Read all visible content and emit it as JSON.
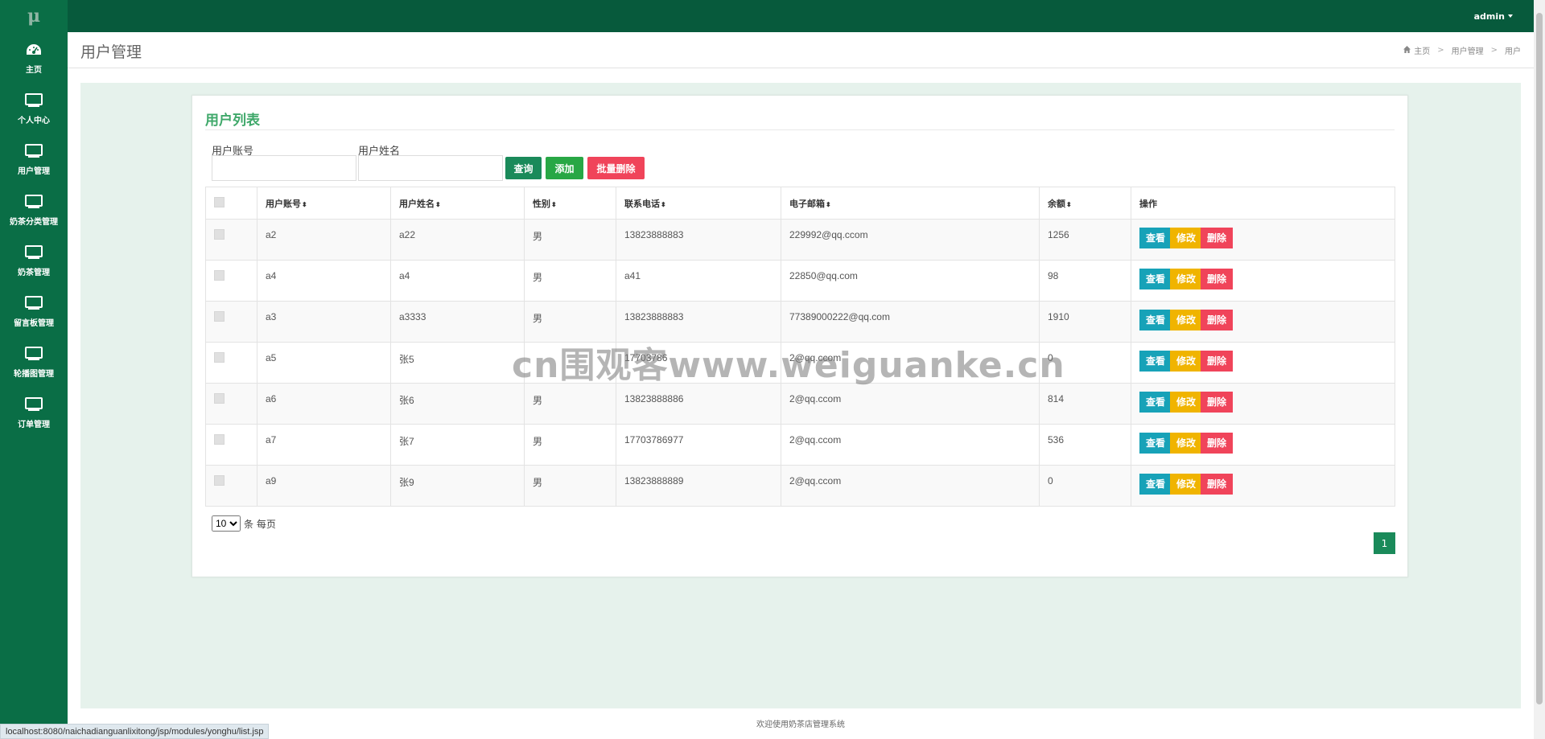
{
  "app": {
    "logo": "μ"
  },
  "sidebar": {
    "items": [
      {
        "label": "主页",
        "icon": "dashboard-icon"
      },
      {
        "label": "个人中心",
        "icon": "monitor-icon"
      },
      {
        "label": "用户管理",
        "icon": "monitor-icon"
      },
      {
        "label": "奶茶分类管理",
        "icon": "monitor-icon"
      },
      {
        "label": "奶茶管理",
        "icon": "monitor-icon"
      },
      {
        "label": "留言板管理",
        "icon": "monitor-icon"
      },
      {
        "label": "轮播图管理",
        "icon": "monitor-icon"
      },
      {
        "label": "订单管理",
        "icon": "monitor-icon"
      }
    ]
  },
  "topbar": {
    "user": "admin"
  },
  "header": {
    "title": "用户管理",
    "breadcrumb": [
      "主页",
      "用户管理",
      "用户"
    ]
  },
  "card": {
    "title": "用户列表",
    "search": {
      "account_label": "用户账号",
      "account_value": "",
      "name_label": "用户姓名",
      "name_value": ""
    },
    "buttons": {
      "query": "查询",
      "add": "添加",
      "batch_delete": "批量删除"
    }
  },
  "table": {
    "columns": [
      "用户账号",
      "用户姓名",
      "性别",
      "联系电话",
      "电子邮箱",
      "余额",
      "操作"
    ],
    "rows": [
      [
        "a2",
        "a22",
        "男",
        "13823888883",
        "229992@qq.ccom",
        "1256"
      ],
      [
        "a4",
        "a4",
        "男",
        "a41",
        "22850@qq.com",
        "98"
      ],
      [
        "a3",
        "a3333",
        "男",
        "13823888883",
        "77389000222@qq.com",
        "1910"
      ],
      [
        "a5",
        "张5",
        "",
        "17703786",
        "2@qq.ccom",
        "0"
      ],
      [
        "a6",
        "张6",
        "男",
        "13823888886",
        "2@qq.ccom",
        "814"
      ],
      [
        "a7",
        "张7",
        "男",
        "17703786977",
        "2@qq.ccom",
        "536"
      ],
      [
        "a9",
        "张9",
        "男",
        "13823888889",
        "2@qq.ccom",
        "0"
      ]
    ],
    "actions": {
      "view": "查看",
      "edit": "修改",
      "delete": "删除"
    }
  },
  "pagination": {
    "page_size": "10",
    "page_size_suffix": "条 每页",
    "current_page": "1"
  },
  "footer": "欢迎使用奶茶店管理系统",
  "status_url": "localhost:8080/naichadianguanlixitong/jsp/modules/yonghu/list.jsp",
  "watermark": "cn围观客www.weiguanke.cn",
  "colors": {
    "sidebar": "#0a6e46",
    "topbar": "#075a3c",
    "title_green": "#3fa86a",
    "btn_query": "#1a8a5a",
    "btn_add": "#28a745",
    "btn_delete": "#f0445a",
    "btn_view": "#17a2b8",
    "btn_edit": "#f0b400"
  }
}
